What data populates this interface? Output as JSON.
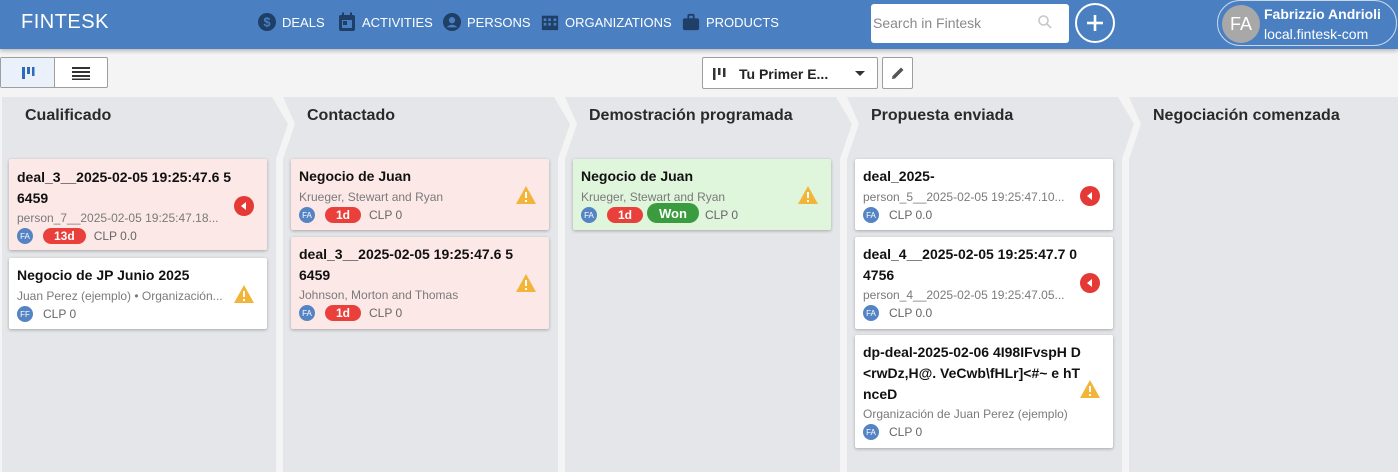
{
  "app": {
    "brand": "FINTESK"
  },
  "nav": [
    {
      "label": "DEALS",
      "icon": "dollar-icon"
    },
    {
      "label": "ACTIVITIES",
      "icon": "calendar-icon"
    },
    {
      "label": "PERSONS",
      "icon": "person-icon"
    },
    {
      "label": "ORGANIZATIONS",
      "icon": "building-icon"
    },
    {
      "label": "PRODUCTS",
      "icon": "briefcase-icon"
    }
  ],
  "search": {
    "placeholder": "Search in Fintesk",
    "value": ""
  },
  "user": {
    "initials": "FA",
    "name": "Fabrizzio Andrioli",
    "domain": "local.fintesk-com"
  },
  "toolbar": {
    "pipeline_label": "Tu Primer E..."
  },
  "colors": {
    "topbar": "#4a7fc2",
    "badge_red": "#e9403c",
    "won": "#3a9b3f",
    "card_red": "#fde8e8",
    "card_green": "#dff5dc",
    "warning": "#f2b53a"
  },
  "stages": [
    {
      "name": "Cualificado"
    },
    {
      "name": "Contactado"
    },
    {
      "name": "Demostración programada"
    },
    {
      "name": "Propuesta enviada"
    },
    {
      "name": "Negociación comenzada"
    }
  ],
  "cards": {
    "c1": {
      "title": "deal_3__2025-02-05 19:25:47.6 56459",
      "subtitle": "person_7__2025-02-05 19:25:47.18...",
      "avatar": "FA",
      "badge": "13d",
      "amount": "CLP 0.0"
    },
    "c2": {
      "title": "Negocio de JP Junio 2025",
      "subtitle": "Juan Perez (ejemplo) • Organización...",
      "avatar": "FF",
      "amount": "CLP 0"
    },
    "c3": {
      "title": "Negocio de Juan",
      "subtitle": "Krueger, Stewart and Ryan",
      "avatar": "FA",
      "badge": "1d",
      "amount": "CLP 0"
    },
    "c4": {
      "title": "deal_3__2025-02-05 19:25:47.6 56459",
      "subtitle": "Johnson, Morton and Thomas",
      "avatar": "FA",
      "badge": "1d",
      "amount": "CLP 0"
    },
    "c5": {
      "title": "Negocio de Juan",
      "subtitle": "Krueger, Stewart and Ryan",
      "avatar": "FA",
      "badge": "1d",
      "status": "Won",
      "amount": "CLP 0"
    },
    "c6": {
      "title": "deal_2025-",
      "subtitle": "person_5__2025-02-05 19:25:47.10...",
      "avatar": "FA",
      "amount": "CLP 0.0"
    },
    "c7": {
      "title": "deal_4__2025-02-05 19:25:47.7 04756",
      "subtitle": "person_4__2025-02-05 19:25:47.05...",
      "avatar": "FA",
      "amount": "CLP 0.0"
    },
    "c8": {
      "title": "dp-deal-2025-02-06 4I98IFvspH D<rwDz,H@. VeCwb\\fHLr]<#~ e hTnceD",
      "subtitle": "Organización de Juan Perez (ejemplo)",
      "avatar": "FA",
      "amount": "CLP 0"
    }
  }
}
